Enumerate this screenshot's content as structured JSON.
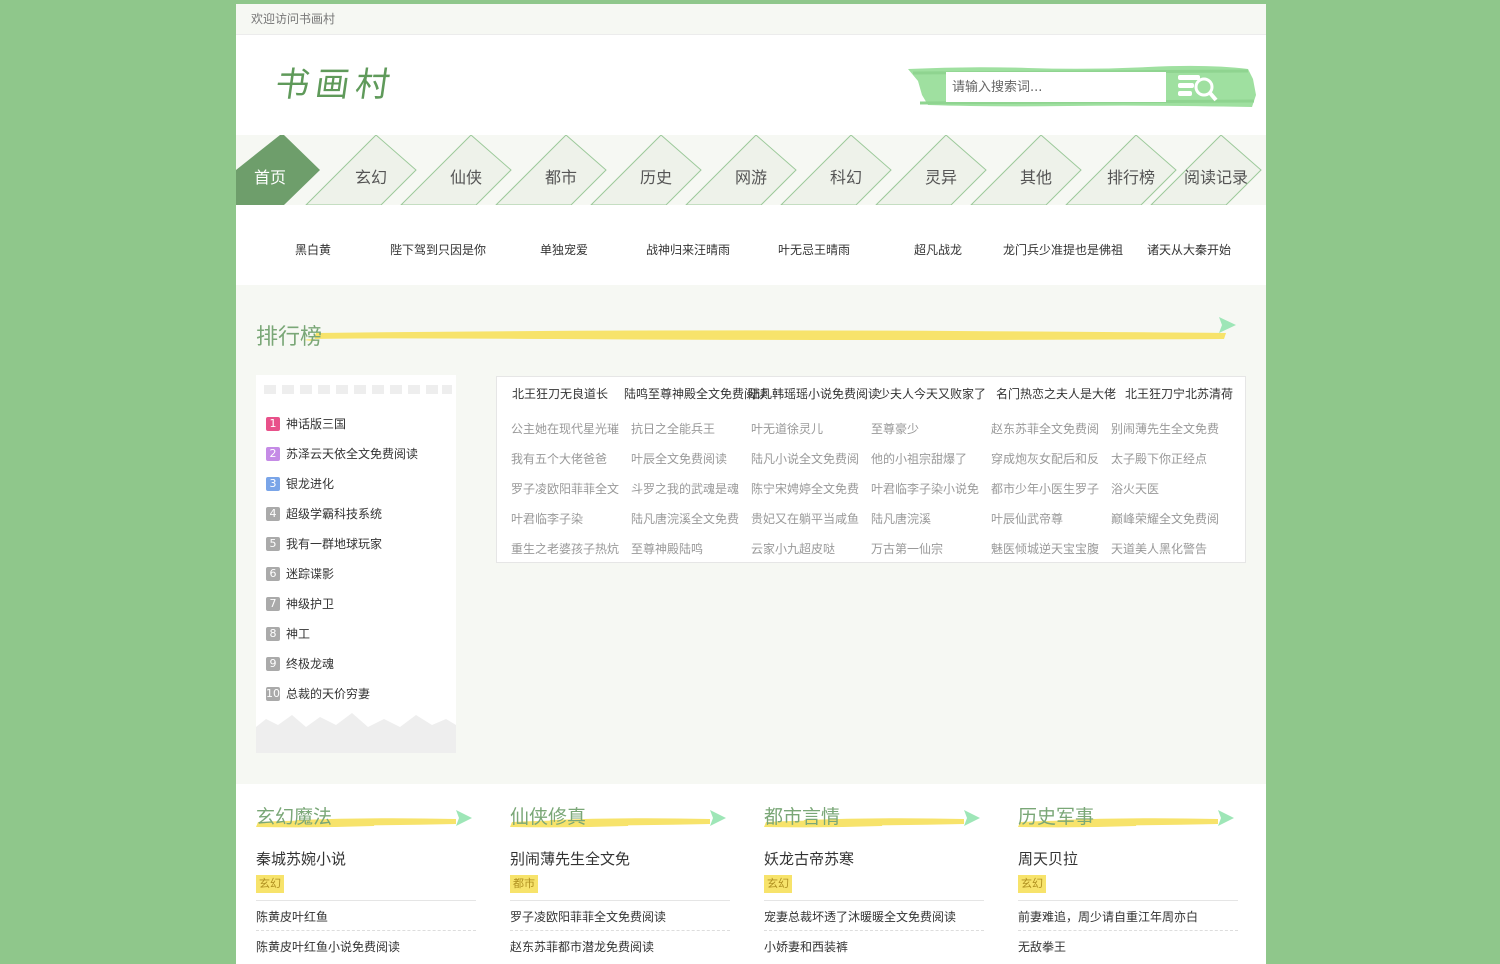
{
  "topbar": {
    "welcome": "欢迎访问书画村"
  },
  "header": {
    "logo": "书画村",
    "search_placeholder": "请输入搜索词..."
  },
  "nav": [
    "首页",
    "玄幻",
    "仙侠",
    "都市",
    "历史",
    "网游",
    "科幻",
    "灵异",
    "其他",
    "排行榜",
    "阅读记录"
  ],
  "hot": [
    "黑白黄",
    "陛下驾到只因是你",
    "单独宠爱",
    "战神归来汪晴雨",
    "叶无忌王晴雨",
    "超凡战龙",
    "龙门兵少准提也是佛祖",
    "诸天从大秦开始"
  ],
  "ranking": {
    "title": "排行榜",
    "top10": [
      "神话版三国",
      "苏泽云天依全文免费阅读",
      "银龙进化",
      "超级学霸科技系统",
      "我有一群地球玩家",
      "迷踪谍影",
      "神级护卫",
      "神工",
      "终极龙魂",
      "总裁的天价穷妻"
    ],
    "headers": [
      "北王狂刀无良道长",
      "陆鸣至尊神殿全文免费阅读",
      "陆凡韩瑶瑶小说免费阅读",
      "少夫人今天又败家了",
      "名门热恋之夫人是大佬",
      "北王狂刀宁北苏清荷"
    ],
    "grid": [
      [
        "公主她在现代星光璀",
        "抗日之全能兵王",
        "叶无道徐灵儿",
        "至尊豪少",
        "赵东苏菲全文免费阅",
        "别闹薄先生全文免费"
      ],
      [
        "我有五个大佬爸爸",
        "叶辰全文免费阅读",
        "陆凡小说全文免费阅",
        "他的小祖宗甜爆了",
        "穿成炮灰女配后和反",
        "太子殿下你正经点"
      ],
      [
        "罗子凌欧阳菲菲全文",
        "斗罗之我的武魂是魂",
        "陈宁宋娉婷全文免费",
        "叶君临李子染小说免",
        "都市少年小医生罗子",
        "浴火天医"
      ],
      [
        "叶君临李子染",
        "陆凡唐浣溪全文免费",
        "贵妃又在躺平当咸鱼",
        "陆凡唐浣溪",
        "叶辰仙武帝尊",
        "巅峰荣耀全文免费阅"
      ],
      [
        "重生之老婆孩子热炕",
        "至尊神殿陆鸣",
        "云家小九超皮哒",
        "万古第一仙宗",
        "魅医倾城逆天宝宝腹",
        "天道美人黑化警告"
      ]
    ]
  },
  "categories": [
    {
      "title": "玄幻魔法",
      "book": "秦城苏婉小说",
      "tag": "玄幻",
      "links": [
        "陈黄皮叶红鱼",
        "陈黄皮叶红鱼小说免费阅读"
      ]
    },
    {
      "title": "仙侠修真",
      "book": "别闹薄先生全文免",
      "tag": "都市",
      "links": [
        "罗子凌欧阳菲菲全文免费阅读",
        "赵东苏菲都市潜龙免费阅读"
      ]
    },
    {
      "title": "都市言情",
      "book": "妖龙古帝苏寒",
      "tag": "玄幻",
      "links": [
        "宠妻总裁坏透了沐暖暖全文免费阅读",
        "小娇妻和西装裤"
      ]
    },
    {
      "title": "历史军事",
      "book": "周天贝拉",
      "tag": "玄幻",
      "links": [
        "前妻难追，周少请自重江年周亦白",
        "无敌拳王"
      ]
    }
  ],
  "colors": {
    "bg": "#8fc78b",
    "accent": "#6e9e6b",
    "yellow": "#f7e36b",
    "rank1": "#e8518a",
    "rank2": "#c58be6",
    "rank3": "#7aa5e8",
    "rankN": "#aaaaaa"
  }
}
